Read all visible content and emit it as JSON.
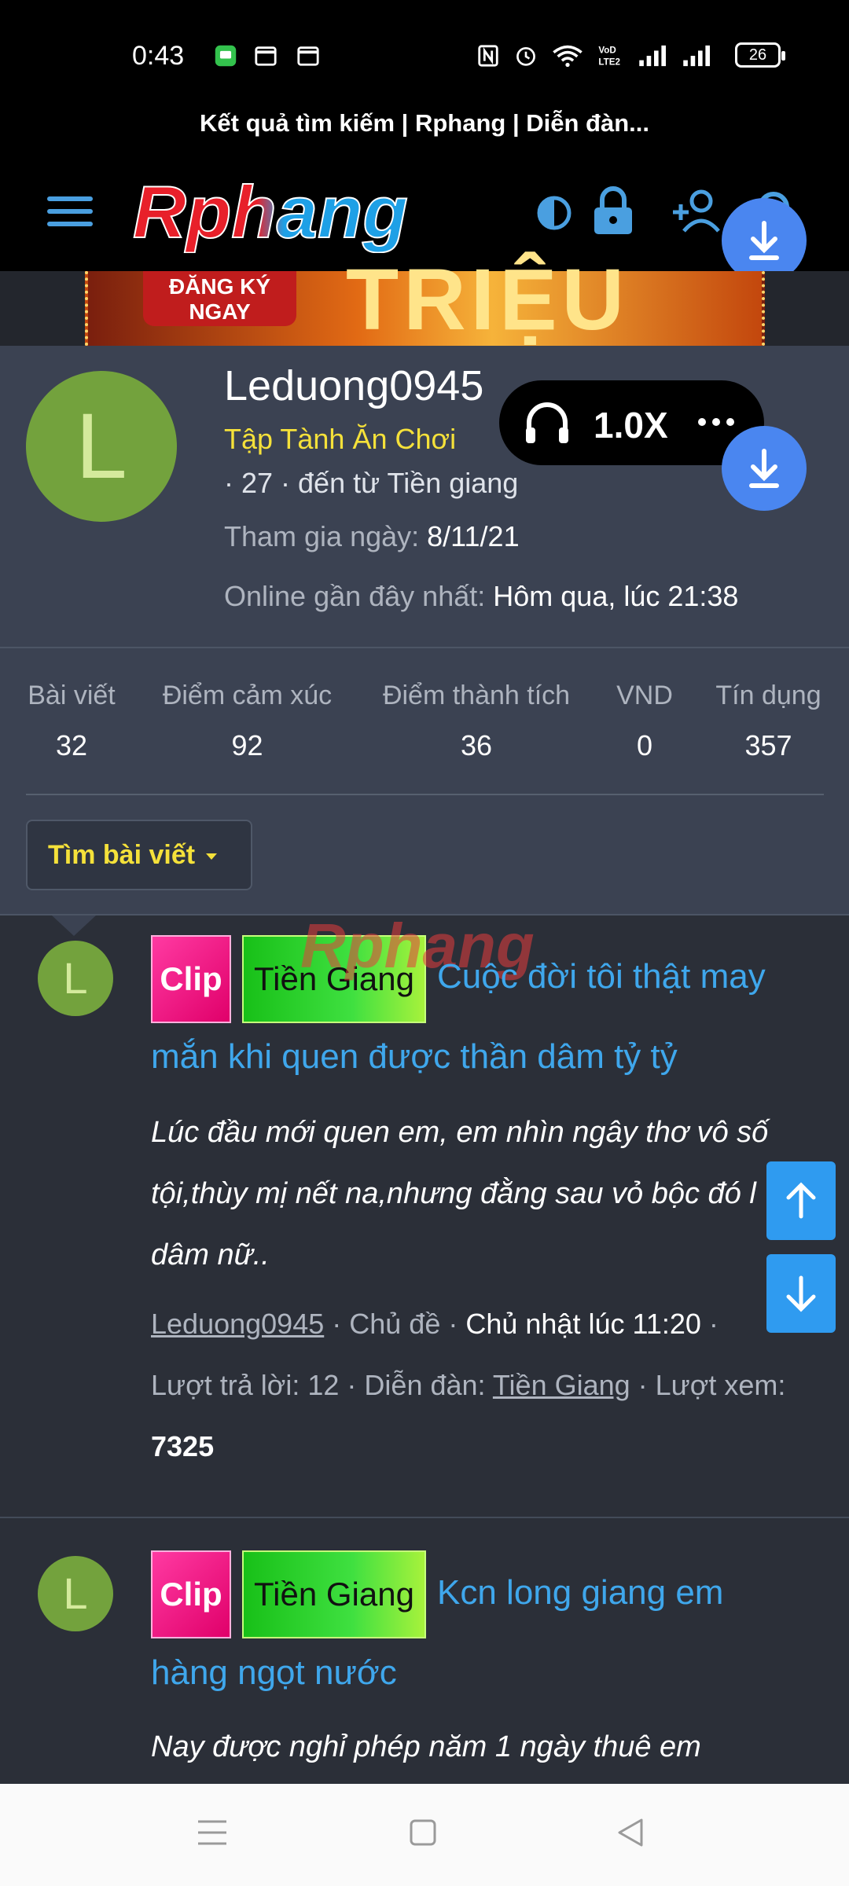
{
  "status_bar": {
    "time": "0:43",
    "battery": "26",
    "icons": [
      "messages-icon",
      "calendar-icon",
      "calendar-icon",
      "nfc-icon",
      "alarm-icon",
      "wifi-icon",
      "volte-icon",
      "signal-icon",
      "signal-icon"
    ]
  },
  "browser": {
    "page_title": "Kết quả tìm kiếm | Rphang | Diễn đàn..."
  },
  "header": {
    "logo_text": "Rphang",
    "icons": [
      "menu-icon",
      "theme-toggle-icon",
      "lock-icon",
      "add-user-icon",
      "search-icon"
    ]
  },
  "banner": {
    "button_text": "ĐĂNG KÝ NGAY",
    "big_text": "TRIỆU"
  },
  "profile": {
    "avatar_letter": "L",
    "username": "Leduong0945",
    "user_title": "Tập Tành Ăn Chơi",
    "info": "· 27 · đến từ Tiền giang",
    "joined_label": "Tham gia ngày:",
    "joined_value": "8/11/21",
    "online_label": "Online gần đây nhất:",
    "online_value": "Hôm qua, lúc 21:38"
  },
  "audio_player": {
    "speed": "1.0X"
  },
  "stats": [
    {
      "label": "Bài viết",
      "value": "32"
    },
    {
      "label": "Điểm cảm xúc",
      "value": "92"
    },
    {
      "label": "Điểm thành tích",
      "value": "36"
    },
    {
      "label": "VND",
      "value": "0"
    },
    {
      "label": "Tín dụng",
      "value": "357"
    }
  ],
  "find_posts_button": "Tìm bài viết",
  "watermark": "Rphang",
  "results": [
    {
      "avatar_letter": "L",
      "tag_type": "Clip",
      "tag_place": "Tiền Giang",
      "title_line1": "Cuộc đời tôi thật may",
      "title_line2": "mắn khi quen được thần dâm tỷ tỷ",
      "snippet_line1": "Lúc đầu mới quen em, em nhìn ngây thơ vô số",
      "snippet_line2": "tội,thùy mị nết na,nhưng đằng sau vỏ bộc đó l",
      "snippet_line3": "dâm nữ..",
      "author": "Leduong0945",
      "kind": "Chủ đề",
      "date": "Chủ nhật lúc 11:20",
      "replies_label": "Lượt trả lời:",
      "replies": "12",
      "forum_label": "Diễn đàn:",
      "forum": "Tiền Giang",
      "views_label": "Lượt xem:",
      "views": "7325"
    },
    {
      "avatar_letter": "L",
      "tag_type": "Clip",
      "tag_place": "Tiền Giang",
      "title_line1": "Kcn long giang em",
      "title_line2": "hàng ngọt nước",
      "snippet_line1": "Nay được nghỉ phép năm 1 ngày thuê em"
    }
  ],
  "colors": {
    "background": "#2b2f38",
    "card": "#3b4252",
    "link": "#3fa7ec",
    "accent_yellow": "#f5e13a",
    "avatar": "#73a23d",
    "fab_blue": "#4a86f0"
  }
}
